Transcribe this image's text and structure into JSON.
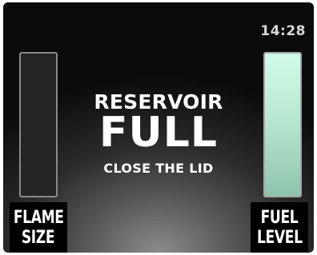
{
  "status_bar": {
    "time": "14:28"
  },
  "gauges": {
    "flame_size": {
      "label_line1": "FLAME",
      "label_line2": "SIZE",
      "level": 0
    },
    "fuel_level": {
      "label_line1": "FUEL",
      "label_line2": "LEVEL",
      "level": 1.0
    }
  },
  "message": {
    "title": "RESERVOIR",
    "main": "FULL",
    "instruction": "CLOSE THE LID"
  },
  "colors": {
    "fuel_fill": "#b9e8d3",
    "text": "#ffffff",
    "clock_text": "#d8d8d8"
  }
}
